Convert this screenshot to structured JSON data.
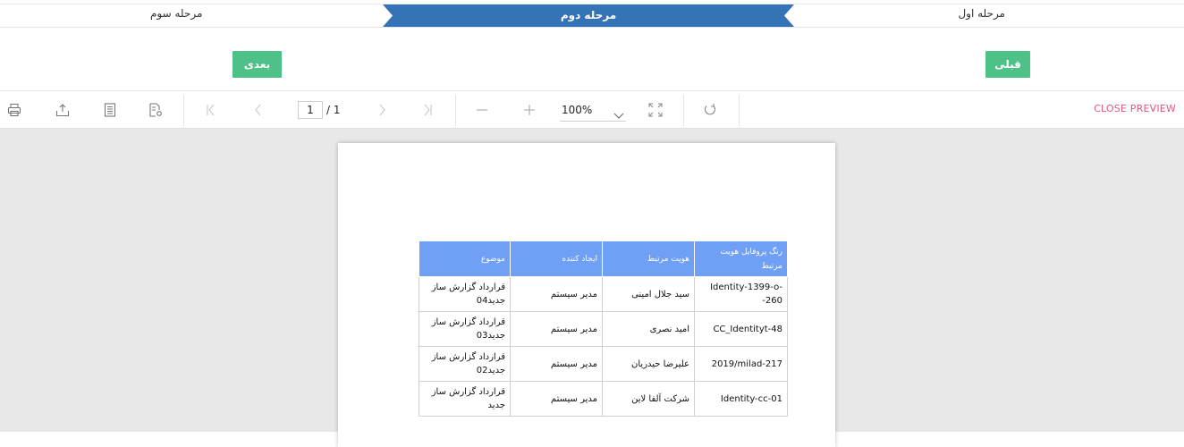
{
  "wizard": {
    "steps": [
      {
        "label": "مرحله اول",
        "state": "done"
      },
      {
        "label": "مرحله دوم",
        "state": "active"
      },
      {
        "label": "مرحله سوم",
        "state": "pending"
      }
    ],
    "active_color": "#3473b6"
  },
  "buttons": {
    "next_label": "بعدی",
    "prev_label": "قبلی",
    "color": "#4dc187"
  },
  "toolbar": {
    "icons": [
      "print-icon",
      "export-icon",
      "document-icon",
      "document-settings-icon",
      "first-page-icon",
      "previous-page-icon",
      "next-page-icon",
      "last-page-icon",
      "zoom-out-icon",
      "zoom-in-icon",
      "fullscreen-icon",
      "refresh-icon"
    ],
    "current_page": "1",
    "page_total": "/ 1",
    "zoom": "100%",
    "close_label": "CLOSE PREVIEW",
    "close_color": "#e0567d"
  },
  "report": {
    "header_color": "#6fa0f5",
    "columns": [
      "رنگ پروفایل هویت مرتبط",
      "هویت مرتبط",
      "ایجاد کننده",
      "موضوع"
    ],
    "rows": [
      [
        "Identity-1399-o--260",
        "سید جلال امینی",
        "مدیر سیستم",
        "قرارداد گزارش ساز جدید04"
      ],
      [
        "CC_Identityt-48",
        "امید نصری",
        "مدیر سیستم",
        "قرارداد گزارش ساز جدید03"
      ],
      [
        "2019/milad-217",
        "علیرضا حیدریان",
        "مدیر سیستم",
        "قرارداد گزارش ساز جدید02"
      ],
      [
        "Identity-cc-01",
        "شرکت آلفا لاین",
        "مدیر سیستم",
        "قرارداد گزارش ساز جدید"
      ]
    ]
  }
}
